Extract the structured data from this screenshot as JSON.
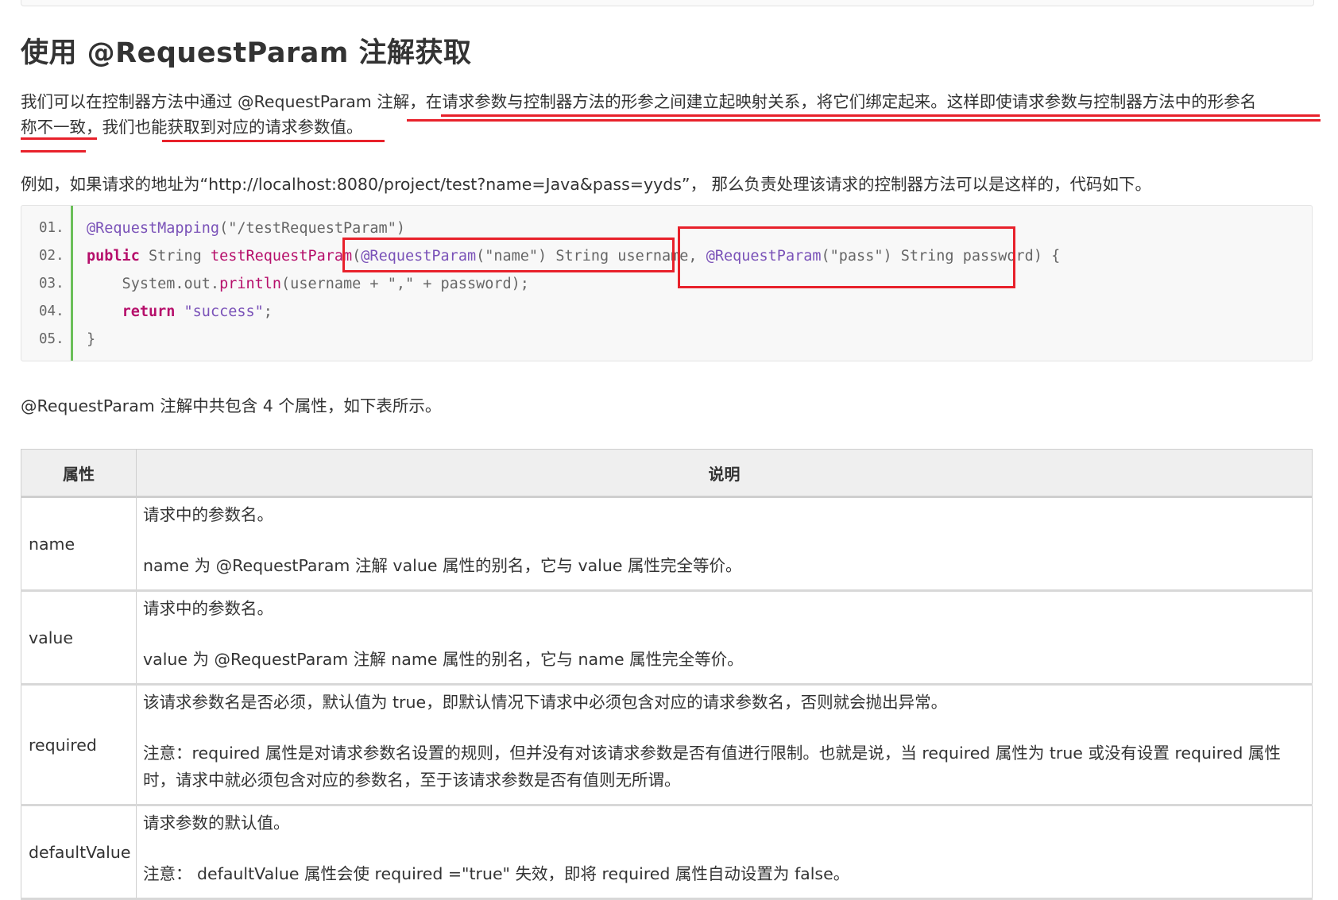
{
  "heading": "使用 @RequestParam 注解获取",
  "intro": {
    "line1_a": "我们可以在控制器方法中通过 @RequestParam 注解，",
    "line1_b": "在请求参数与控制器方法的形参之间建立起映射关系，将它们绑定起来。这样即使请求参数与控制器方法中的形参名",
    "line2_a": "称不一致，",
    "line2_b": "我们也",
    "line2_c": "能获取到对应的请求参数值。"
  },
  "example_text": "例如，如果请求的地址为“http://localhost:8080/project/test?name=Java&pass=yyds”， 那么负责处理该请求的控制器方法可以是这样的，代码如下。",
  "code": {
    "line_numbers": [
      "01.",
      "02.",
      "03.",
      "04.",
      "05."
    ],
    "l1_annotation": "@RequestMapping",
    "l1_args": "(\"/testRequestParam\")",
    "l2_kw": "public",
    "l2_type": " String ",
    "l2_fn": "testRequestParam",
    "l2_paren": "(",
    "l2_ann1": "@RequestParam",
    "l2_arg1": "(\"name\")",
    "l2_p1": " String username,",
    "l2_sp": " ",
    "l2_ann2": "@RequestParam",
    "l2_arg2": "(\"pass\")",
    "l2_p2": " String password)",
    "l2_brace": " {",
    "l3_indent": "    System.out.",
    "l3_fn": "println",
    "l3_rest": "(username + \",\" + password);",
    "l4_indent": "    ",
    "l4_kw": "return",
    "l4_str": " \"success\"",
    "l4_end": ";",
    "l5": "}"
  },
  "table_intro": "@RequestParam 注解中共包含 4 个属性，如下表所示。",
  "table": {
    "headers": [
      "属性",
      "说明"
    ],
    "rows": [
      {
        "name": "name",
        "desc1": "请求中的参数名。",
        "desc2": "name 为 @RequestParam 注解 value 属性的别名，它与 value 属性完全等价。"
      },
      {
        "name": "value",
        "desc1": "请求中的参数名。",
        "desc2": "value 为 @RequestParam 注解 name 属性的别名，它与 name 属性完全等价。"
      },
      {
        "name": "required",
        "desc1": "该请求参数名是否必须，默认值为 true，即默认情况下请求中必须包含对应的请求参数名，否则就会抛出异常。",
        "desc2": "注意：required 属性是对请求参数名设置的规则，但并没有对该请求参数是否有值进行限制。也就是说，当 required 属性为 true 或没有设置 required 属性时，请求中就必须包含对应的参数名，至于该请求参数是否有值则无所谓。"
      },
      {
        "name": "defaultValue",
        "desc1": "请求参数的默认值。",
        "desc2": "注意： defaultValue 属性会使 required =\"true\" 失效，即将 required 属性自动设置为 false。"
      }
    ]
  }
}
